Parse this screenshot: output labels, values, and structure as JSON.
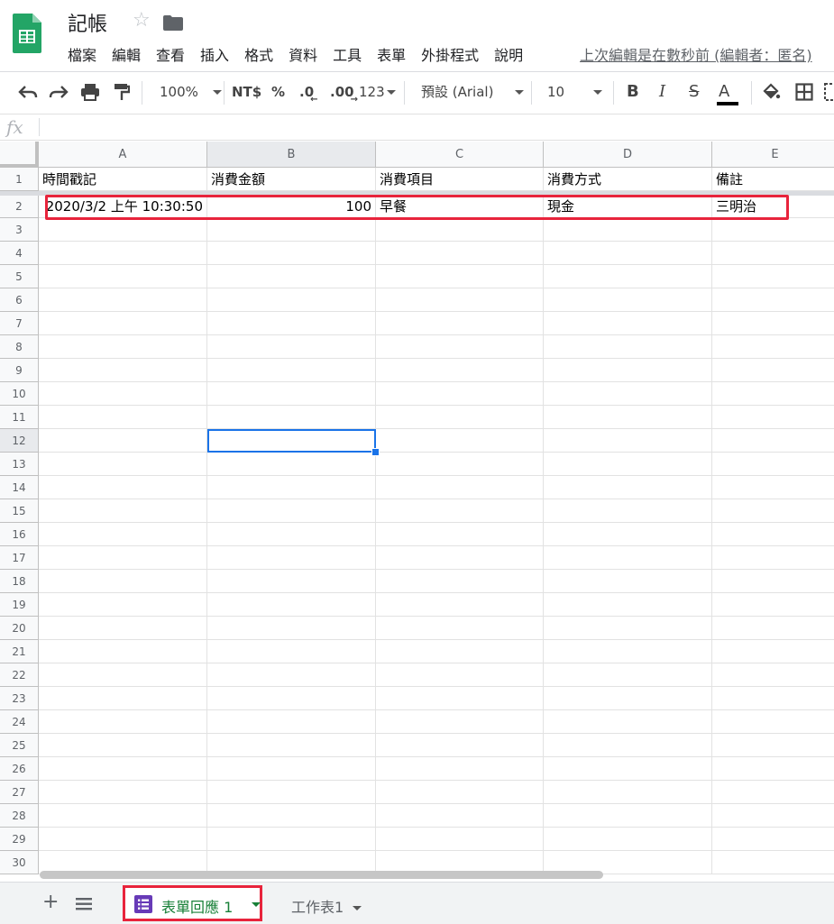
{
  "app": {
    "title": "記帳"
  },
  "menu": [
    "檔案",
    "編輯",
    "查看",
    "插入",
    "格式",
    "資料",
    "工具",
    "表單",
    "外掛程式",
    "說明"
  ],
  "last_edit": "上次編輯是在數秒前 (編輯者：匿名)",
  "toolbar": {
    "zoom": "100%",
    "currency": "NT$",
    "percent": "%",
    "dec_less": ".0",
    "dec_more": ".00",
    "format_more": "123",
    "font": "預設 (Arial)",
    "font_size": "10",
    "bold": "B",
    "italic": "I",
    "strike": "S",
    "text_color": "A"
  },
  "formula_bar": {
    "fx": "fx",
    "value": ""
  },
  "columns": [
    "A",
    "B",
    "C",
    "D",
    "E"
  ],
  "rows": [
    "1",
    "2",
    "3",
    "4",
    "5",
    "6",
    "7",
    "8",
    "9",
    "10",
    "11",
    "12",
    "13",
    "14",
    "15",
    "16",
    "17",
    "18",
    "19",
    "20",
    "21",
    "22",
    "23",
    "24",
    "25",
    "26",
    "27",
    "28",
    "29",
    "30"
  ],
  "cells": {
    "header": [
      "時間戳記",
      "消費金額",
      "消費項目",
      "消費方式",
      "備註"
    ],
    "row2": [
      "2020/3/2 上午 10:30:50",
      "100",
      "早餐",
      "現金",
      "三明治"
    ]
  },
  "sheets": [
    {
      "label": "表單回應 1",
      "active": true
    },
    {
      "label": "工作表1",
      "active": false
    }
  ],
  "colors": {
    "accent": "#1a73e8",
    "highlight": "#e8243c",
    "sheets_green": "#188038",
    "forms_purple": "#673ab7"
  }
}
